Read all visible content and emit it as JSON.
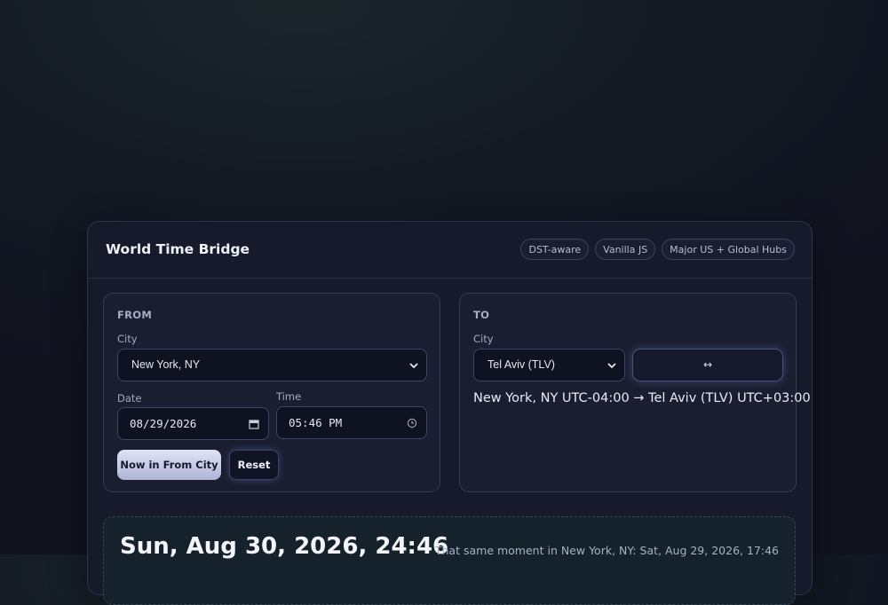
{
  "header": {
    "title": "World Time Bridge",
    "badges": [
      "DST-aware",
      "Vanilla JS",
      "Major US + Global Hubs"
    ]
  },
  "from": {
    "title": "FROM",
    "city_label": "City",
    "city_value": "New York, NY",
    "date_label": "Date",
    "date_value": "08/29/2026",
    "time_label": "Time",
    "time_value": "05:46 PM",
    "now_button": "Now in From City",
    "reset_button": "Reset"
  },
  "to": {
    "title": "TO",
    "city_label": "City",
    "city_value": "Tel Aviv (TLV)",
    "swap_button": "↔",
    "offset_text": "New York, NY UTC-04:00 → Tel Aviv (TLV) UTC+03:00"
  },
  "result": {
    "converted": "Sun, Aug 30, 2026, 24:46",
    "same_moment": "That same moment in New York, NY: Sat, Aug 29, 2026, 17:46"
  },
  "icons": {
    "select_chevron": "chevron-down-icon",
    "date": "calendar-icon",
    "time": "clock-icon"
  }
}
